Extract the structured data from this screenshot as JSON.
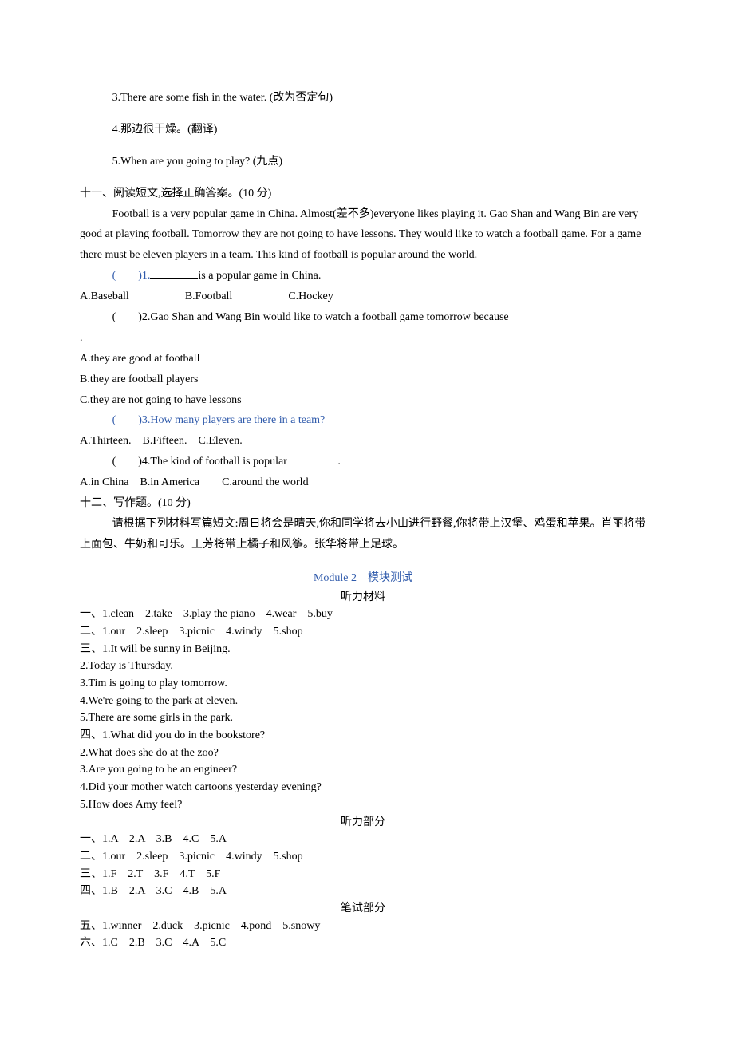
{
  "q10": {
    "q3": "3.There are some fish in the water. (改为否定句)",
    "q4": "4.那边很干燥。(翻译)",
    "q5": "5.When are you going to play? (九点)"
  },
  "sec11": {
    "title": "十一、阅读短文,选择正确答案。(10 分)",
    "passage": "Football is a very popular game in China. Almost(差不多)everyone likes playing it. Gao Shan and Wang Bin are very good at playing football. Tomorrow they are not going to have lessons. They would like to watch a football game. For a game there must be eleven players in a team. This kind of football is popular around the world.",
    "q1_pre": "(　　)1.",
    "q1_post": "is a popular game in China.",
    "q1_opts": "A.Baseball　　　　　B.Football　　　　　C.Hockey",
    "q2": "(　　)2.Gao Shan and Wang Bin would like to watch a football game tomorrow because ",
    "q2_dot": ".",
    "q2a": "A.they are good at football",
    "q2b": "B.they are football players",
    "q2c": "C.they are not going to have lessons",
    "q3": "(　　)3.How many players are there in a team?",
    "q3_opts": "A.Thirteen.　B.Fifteen.　C.Eleven.",
    "q4_pre": "(　　)4.The kind of football is popular ",
    "q4_post": ".",
    "q4_opts": "A.in China　B.in America　　C.around the world"
  },
  "sec12": {
    "title": "十二、写作题。(10 分)",
    "prompt": "请根据下列材料写篇短文:周日将会是晴天,你和同学将去小山进行野餐,你将带上汉堡、鸡蛋和苹果。肖丽将带上面包、牛奶和可乐。王芳将带上橘子和风筝。张华将带上足球。"
  },
  "answers": {
    "title": "Module 2　模块测试",
    "sub1": "听力材料",
    "a1": "一、1.clean　2.take　3.play the piano　4.wear　5.buy",
    "a2": "二、1.our　2.sleep　3.picnic　4.windy　5.shop",
    "a3": "三、1.It will be sunny in Beijing.",
    "a3_2": "2.Today is Thursday.",
    "a3_3": "3.Tim is going to play tomorrow.",
    "a3_4": "4.We're going to the park at eleven.",
    "a3_5": "5.There are some girls in the park.",
    "a4": "四、1.What did you do in the bookstore?",
    "a4_2": "2.What does she do at the zoo?",
    "a4_3": "3.Are you going to be an engineer?",
    "a4_4": "4.Did your mother watch cartoons yesterday evening?",
    "a4_5": "5.How does Amy feel?",
    "sub2": "听力部分",
    "b1": "一、1.A　2.A　3.B　4.C　5.A",
    "b2": "二、1.our　2.sleep　3.picnic　4.windy　5.shop",
    "b3": "三、1.F　2.T　3.F　4.T　5.F",
    "b4": "四、1.B　2.A　3.C　4.B　5.A",
    "sub3": "笔试部分",
    "c1": "五、1.winner　2.duck　3.picnic　4.pond　5.snowy",
    "c2": "六、1.C　2.B　3.C　4.A　5.C"
  }
}
